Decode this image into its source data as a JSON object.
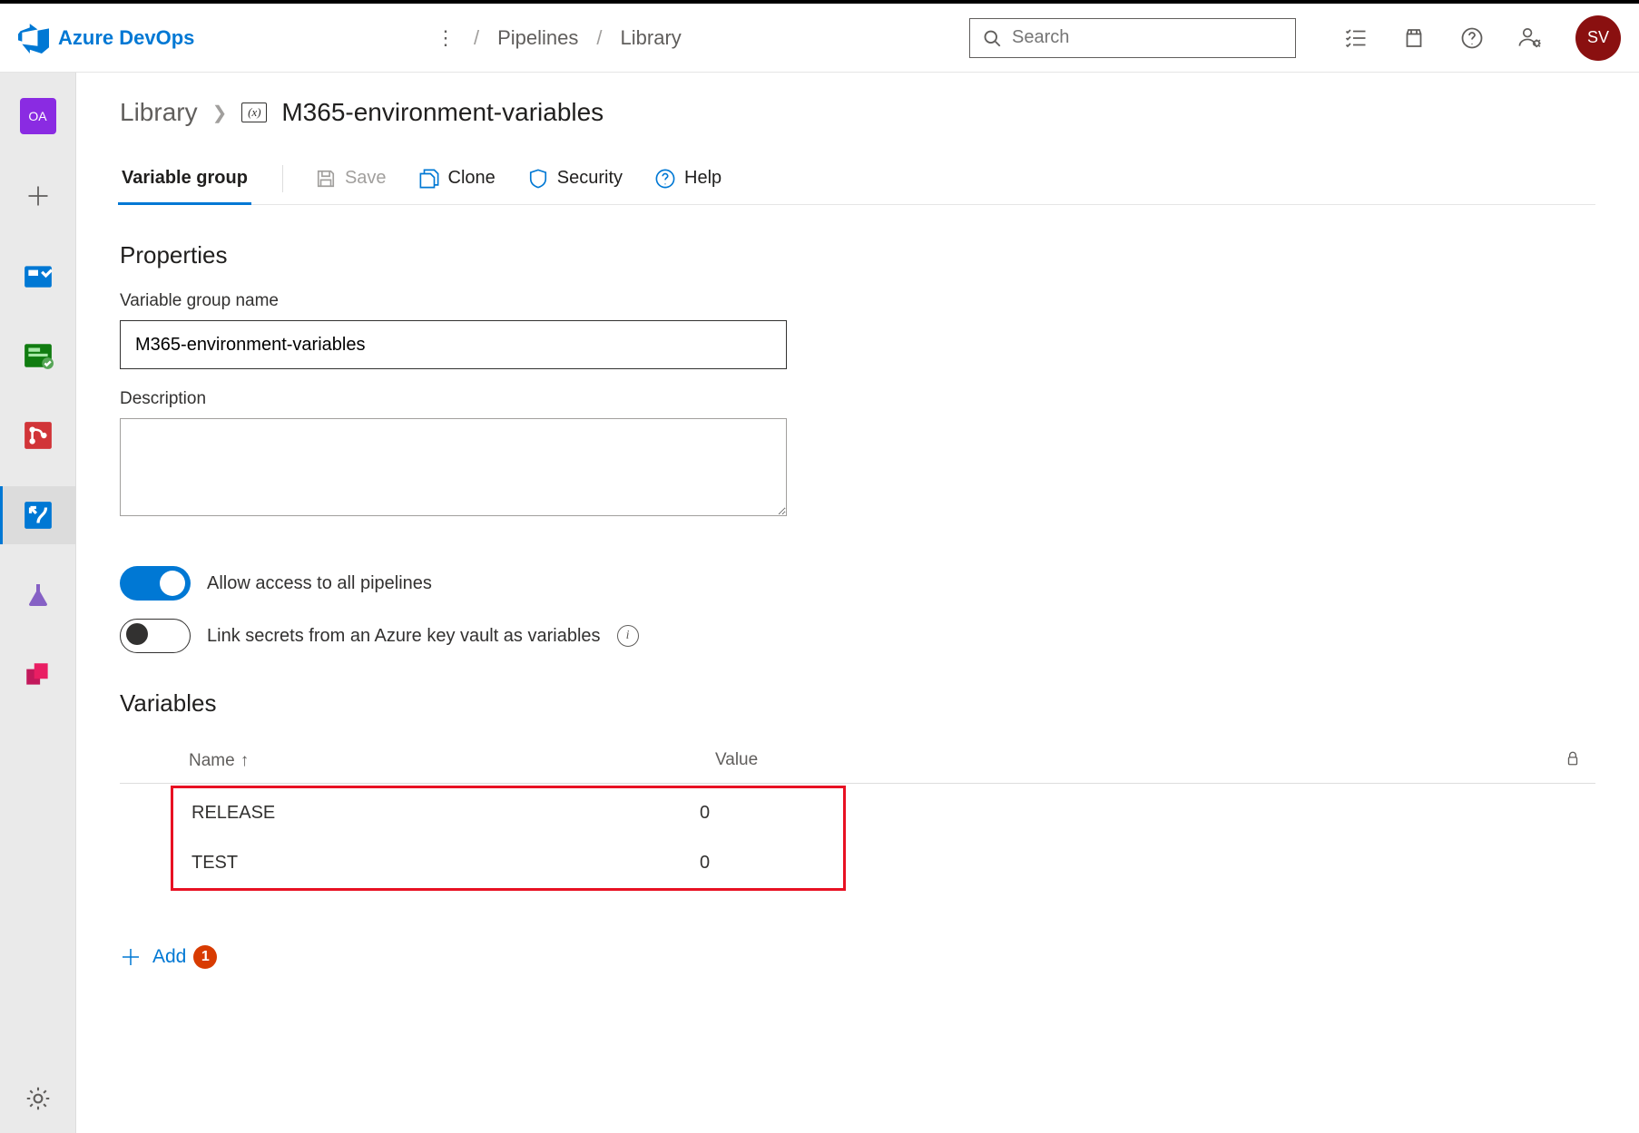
{
  "header": {
    "product": "Azure DevOps",
    "breadcrumb": [
      "Pipelines",
      "Library"
    ],
    "search_placeholder": "Search",
    "avatar_initials": "SV"
  },
  "sidebar": {
    "project_initials": "OA"
  },
  "page": {
    "breadcrumb_root": "Library",
    "vg_icon_text": "(x)",
    "title": "M365-environment-variables",
    "tabs": {
      "variable_group": "Variable group"
    },
    "toolbar": {
      "save": "Save",
      "clone": "Clone",
      "security": "Security",
      "help": "Help"
    }
  },
  "properties": {
    "section_title": "Properties",
    "name_label": "Variable group name",
    "name_value": "M365-environment-variables",
    "description_label": "Description",
    "description_value": "",
    "toggle_allow_label": "Allow access to all pipelines",
    "toggle_link_label": "Link secrets from an Azure key vault as variables"
  },
  "variables": {
    "section_title": "Variables",
    "columns": {
      "name": "Name",
      "value": "Value"
    },
    "rows": [
      {
        "name": "RELEASE",
        "value": "0"
      },
      {
        "name": "TEST",
        "value": "0"
      }
    ],
    "add_label": "Add",
    "callout_number": "1"
  }
}
